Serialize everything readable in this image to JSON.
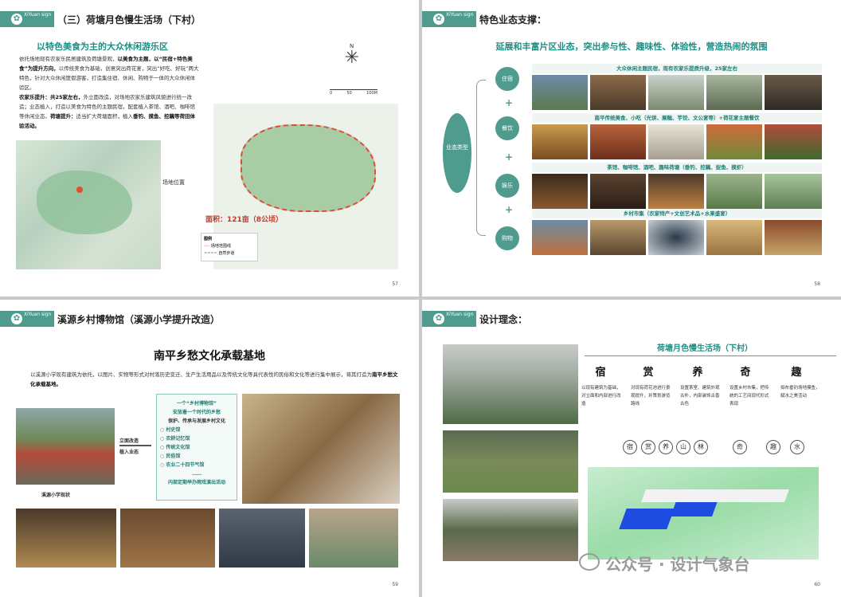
{
  "logo_text": "XiYuan sign",
  "pages": [
    {
      "number": "57",
      "title": "（三）荷塘月色慢生活场（下村）",
      "heading": "以特色美食为主的大众休闲游乐区",
      "para1_a": "依托场地现有农家乐民居建筑及荷塘景观，",
      "para1_b": "以美食为主题，",
      "para1_c": "以“民宿+特色美食”为提升方向，",
      "para1_d": "以传统美食为基础，创意突出荷花宴，突出“好吃、好玩”两大特色，针对大众休闲度假游客，打造集住宿、休闲、购物于一体的大众休闲体验区。",
      "para2_a": "农家乐提升：共25家左右，",
      "para2_b": "外立面改造，对场地农家乐建筑风貌进行统一改造；业态植入，打造以美食为特色的主题民宿，配套植入茶馆、酒吧、咖啡馆等休闲业态。",
      "para2_c": "荷塘提升：",
      "para2_d": "适当扩大荷塘面积，植入",
      "para2_e": "垂钓、摸鱼、挖藕等荷田体验活动。",
      "location_label": "场地位置",
      "area_label": "面积：121亩（8公顷）",
      "legend_title": "图例",
      "legend_1": "场地范围线",
      "legend_2": "自然步道",
      "scale": [
        "0",
        "50",
        "100M"
      ],
      "compass": "N"
    },
    {
      "number": "58",
      "title": "特色业态支撑：",
      "subtitle": "延展和丰富片区业态，突出参与性、趣味性、体验性，营造热闹的氛围",
      "center_label": "业态类型",
      "categories": [
        {
          "label": "住宿",
          "desc": "大众休闲主题民宿，现有农家乐提质升级，25家左右"
        },
        {
          "label": "餐饮",
          "desc": "南平传统美食、小吃（光饼、粟糍、芋饺、文公宴等）+荷花宴主题餐饮"
        },
        {
          "label": "娱乐",
          "desc": "茶馆、咖啡馆、酒吧、趣味荷塘（垂钓、挖藕、捉鱼、摸虾）"
        },
        {
          "label": "购物",
          "desc": "乡村市集（农家特产+文创艺术品+水果盛宴）"
        }
      ],
      "plus": "+"
    },
    {
      "number": "59",
      "title": "溪源乡村博物馆（溪源小学提升改造）",
      "heading": "南平乡愁文化承载基地",
      "para_a": "以溪源小学现有建筑为依托，以图片、实物等形式对村落历史变迁、生产生活用品以及传统文化等具代表性的民俗和文化等进行集中展示，将其打造为",
      "para_b": "南平乡愁文化承载基地。",
      "arrow_1": "立面改造",
      "arrow_2": "植入业态",
      "box_lines": [
        "一个“乡村博物馆”",
        "安放着一个时代的乡愁",
        "保护、传承与发展乡村文化",
        "○ 村史馆",
        "○ 农耕记忆馆",
        "○ 传统文化馆",
        "○ 民俗馆",
        "○ 农业二十四节气馆",
        "……",
        "内部定期举办雨戏演出活动"
      ],
      "caption": "溪源小学现状"
    },
    {
      "number": "60",
      "title": "设计理念：",
      "subtitle": "荷塘月色慢生活场（下村）",
      "concepts": [
        {
          "char": "宿",
          "desc": "以现有建筑为基础，对立面和内部进行改造"
        },
        {
          "char": "赏",
          "desc": "对现有荷花池进行景观提升，并策划游览路线"
        },
        {
          "char": "养",
          "desc": "设置茶室、建筑外观古朴，内部装饰古香古色"
        },
        {
          "char": "奇",
          "desc": "设置乡村市集，把传统的工艺间现代形式表现"
        },
        {
          "char": "趣",
          "desc": "拟布垂钓场地摸鱼，赋水之美活动"
        }
      ],
      "tags": [
        "宿",
        "赏",
        "养",
        "山",
        "林",
        "奇",
        "趣",
        "水"
      ]
    }
  ],
  "watermark": "公众号 · 设计气象台"
}
